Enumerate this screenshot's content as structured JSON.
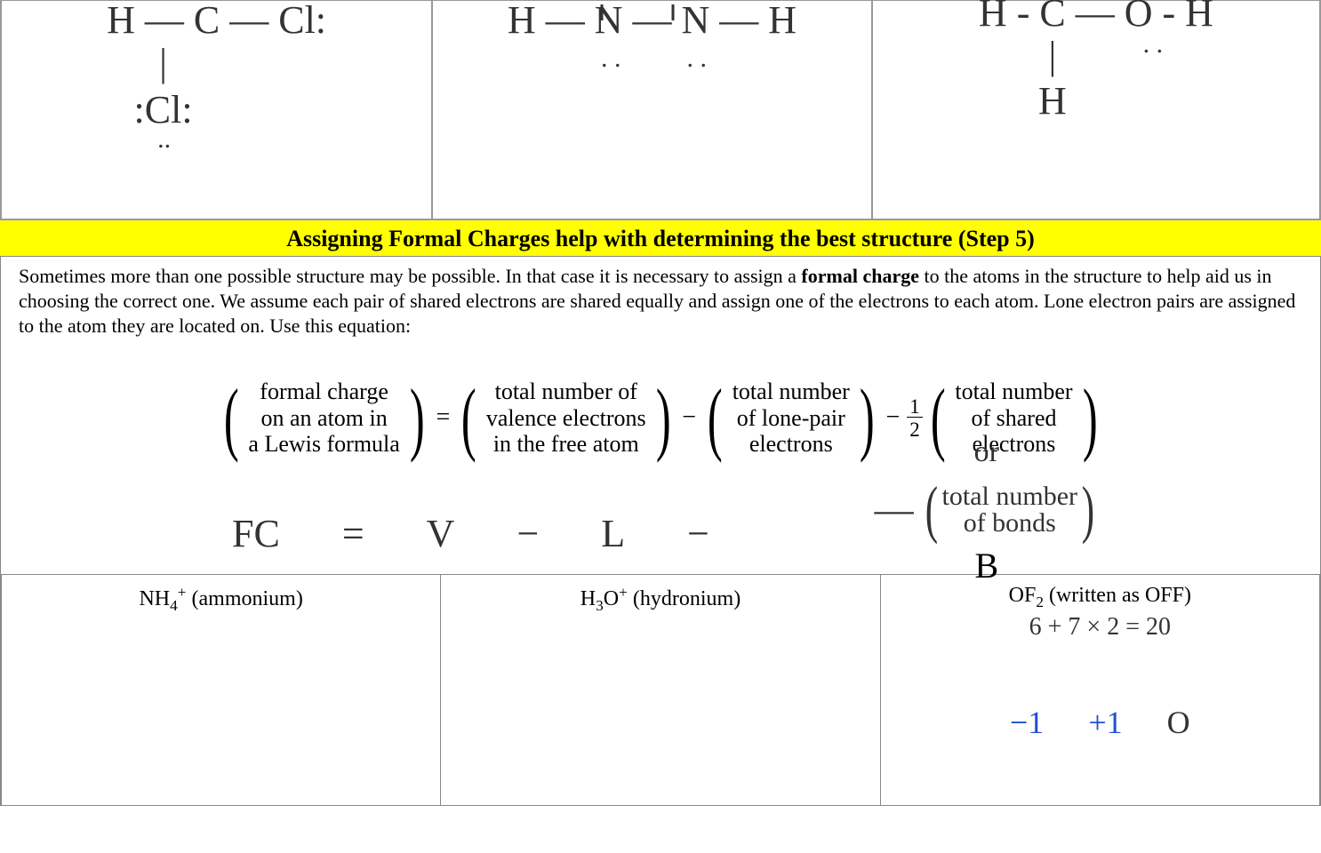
{
  "topStructures": {
    "cell1_line1": "H — C — Cl:",
    "cell1_line2": "|",
    "cell1_line3": ":Cl:",
    "cell2_line1": "H — N — N — H",
    "cell3_line1": "H - C — O - H",
    "cell3_line2": "|",
    "cell3_line3": "H"
  },
  "yellowBar": "Assigning Formal Charges help with determining the best structure (Step 5)",
  "mainText": {
    "t1": "Sometimes more than one possible structure may be possible. In that case it is necessary to assign a ",
    "bold1": "formal charge",
    "t2": " to the atoms in the structure to help aid us in choosing the correct one. We assume each pair of shared electrons are shared equally and assign one of the electrons to each atom. Lone electron pairs are assigned to the atom they are located on. Use this equation:"
  },
  "formula": {
    "p1_l1": "formal charge",
    "p1_l2": "on an atom in",
    "p1_l3": "a Lewis formula",
    "eq": "=",
    "p2_l1": "total number of",
    "p2_l2": "valence electrons",
    "p2_l3": "in the free atom",
    "minus": "−",
    "p3_l1": "total number",
    "p3_l2": "of lone-pair",
    "p3_l3": "electrons",
    "half_num": "1",
    "half_den": "2",
    "p4_l1": "total number",
    "p4_l2": "of shared",
    "p4_l3": "electrons"
  },
  "hw": {
    "or": "or",
    "bonds_l1": "total number",
    "bonds_l2": "of bonds",
    "B": "B",
    "fc": "FC",
    "eq": "=",
    "V": "V",
    "minus1": "−",
    "L": "L",
    "minus2": "−"
  },
  "bottom": {
    "c1_name": "NH",
    "c1_sub": "4",
    "c1_sup": "+",
    "c1_paren": " (ammonium)",
    "c2_name": "H",
    "c2_sub": "3",
    "c2_name2": "O",
    "c2_sup": "+",
    "c2_paren": " (hydronium)",
    "c3_name": "OF",
    "c3_sub": "2",
    "c3_paren": " (written as OFF)",
    "c3_calc": "6 + 7 × 2  = 20",
    "c3_ch1": "−1",
    "c3_ch2": "+1",
    "c3_ch3": "O"
  }
}
